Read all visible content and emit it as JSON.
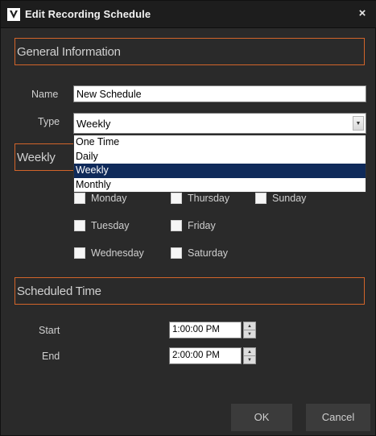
{
  "window": {
    "title": "Edit Recording Schedule",
    "close_symbol": "×"
  },
  "general": {
    "section_title": "General Information",
    "name_label": "Name",
    "name_value": "New Schedule",
    "type_label": "Type",
    "type_value": "Weekly",
    "type_options": [
      "One Time",
      "Daily",
      "Weekly",
      "Monthly"
    ],
    "type_selected_option": "Weekly"
  },
  "weekly": {
    "section_title": "Weekly",
    "days": [
      {
        "label": "Monday",
        "checked": false
      },
      {
        "label": "Tuesday",
        "checked": false
      },
      {
        "label": "Wednesday",
        "checked": false
      },
      {
        "label": "Thursday",
        "checked": false
      },
      {
        "label": "Friday",
        "checked": false
      },
      {
        "label": "Saturday",
        "checked": false
      },
      {
        "label": "Sunday",
        "checked": false
      }
    ]
  },
  "scheduled_time": {
    "section_title": "Scheduled Time",
    "start_label": "Start",
    "start_value": "1:00:00 PM",
    "end_label": "End",
    "end_value": "2:00:00 PM"
  },
  "buttons": {
    "ok": "OK",
    "cancel": "Cancel"
  },
  "colors": {
    "accent": "#d2642a",
    "selected_option": "#0f2a5a",
    "dialog_bg": "#2a2a2a"
  }
}
